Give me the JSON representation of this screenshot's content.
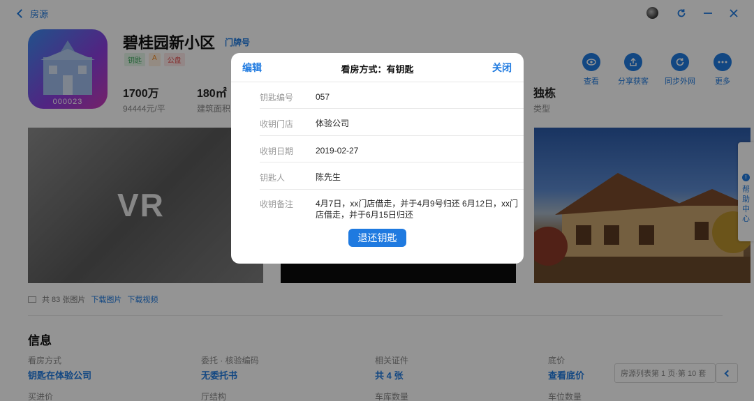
{
  "nav": {
    "back_label": "房源"
  },
  "house": {
    "cover_code": "000023",
    "title": "碧桂园新小区",
    "tag_link": "门牌号",
    "badges": [
      "钥匙",
      "A",
      "公盘"
    ],
    "price_value": "1700万",
    "price_label": "94444元/平",
    "area_value": "180㎡",
    "area_label": "建筑面积",
    "type_value": "独栋",
    "type_label": "类型"
  },
  "actions": [
    {
      "label": "查看",
      "icon": "eye-icon"
    },
    {
      "label": "分享获客",
      "icon": "share-icon"
    },
    {
      "label": "同步外网",
      "icon": "sync-icon"
    },
    {
      "label": "更多",
      "icon": "more-icon"
    }
  ],
  "media": {
    "vr_label": "VR",
    "count_text": "共 83 张图片",
    "download_images": "下载图片",
    "download_video": "下载视频"
  },
  "info": {
    "title": "信息",
    "cells": [
      {
        "label": "看房方式",
        "value": "钥匙在体验公司"
      },
      {
        "label": "委托 · 核验编码",
        "value": "无委托书"
      },
      {
        "label": "相关证件",
        "value": "共 4 张"
      },
      {
        "label": "底价",
        "value": "查看底价"
      }
    ],
    "row2_labels": [
      "买进价",
      "厅结构",
      "车库数量",
      "车位数量"
    ]
  },
  "pager": {
    "text": "房源列表第 1 页·第 10 套"
  },
  "help": {
    "text": "帮助中心"
  },
  "modal": {
    "edit": "编辑",
    "title": "看房方式：有钥匙",
    "close": "关闭",
    "rows": [
      {
        "label": "钥匙编号",
        "value": "057"
      },
      {
        "label": "收钥门店",
        "value": "体验公司"
      },
      {
        "label": "收钥日期",
        "value": "2019-02-27"
      },
      {
        "label": "钥匙人",
        "value": "陈先生"
      },
      {
        "label": "收钥备注",
        "value": "4月7日，xx门店借走，并于4月9号归还 6月12日，xx门店借走，并于6月15日归还"
      }
    ],
    "return_button": "退还钥匙"
  },
  "colors": {
    "accent": "#1f7ae0",
    "overlay": "rgba(0,0,0,0.42)"
  }
}
